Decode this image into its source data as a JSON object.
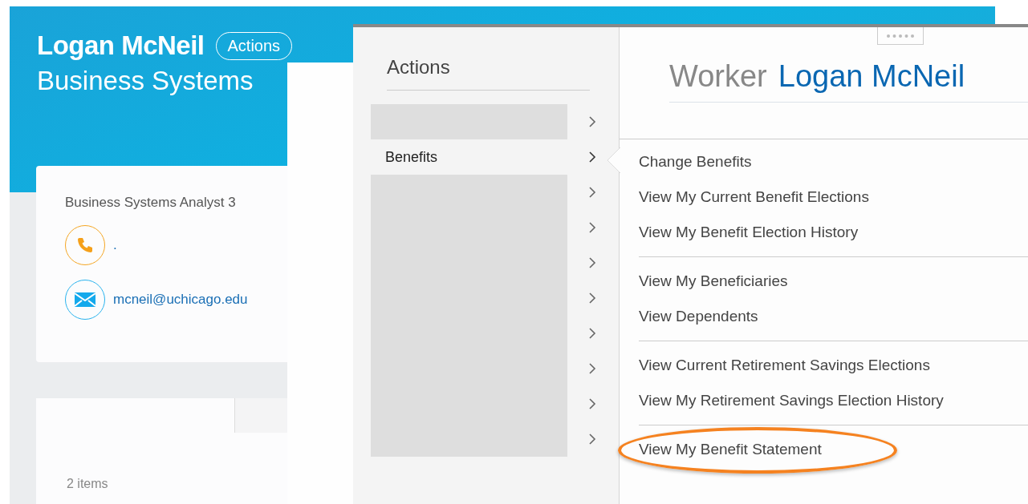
{
  "profile": {
    "name": "Logan McNeil",
    "actions_button": "Actions",
    "subtitle": "Business Systems",
    "job_title": "Business Systems Analyst 3",
    "phone": ".",
    "email": "mcneil@uchicago.edu",
    "items_count": "2 items"
  },
  "actions_menu": {
    "title": "Actions",
    "items": [
      {
        "kind": "redacted"
      },
      {
        "kind": "item",
        "label": "Benefits",
        "expanded": true
      },
      {
        "kind": "redacted"
      },
      {
        "kind": "redacted"
      },
      {
        "kind": "redacted"
      },
      {
        "kind": "redacted"
      },
      {
        "kind": "redacted"
      },
      {
        "kind": "redacted"
      },
      {
        "kind": "redacted"
      },
      {
        "kind": "redacted"
      }
    ]
  },
  "worker_panel": {
    "label": "Worker",
    "name": "Logan McNeil"
  },
  "submenu": {
    "groups": [
      [
        {
          "label": "Change Benefits",
          "highlighted": false
        },
        {
          "label": "View My Current Benefit Elections",
          "highlighted": false
        },
        {
          "label": "View My Benefit Election History",
          "highlighted": false
        }
      ],
      [
        {
          "label": "View My Beneficiaries",
          "highlighted": false
        },
        {
          "label": "View Dependents",
          "highlighted": false
        }
      ],
      [
        {
          "label": "View Current Retirement Savings Elections",
          "highlighted": false
        },
        {
          "label": "View My Retirement Savings Election History",
          "highlighted": false
        }
      ],
      [
        {
          "label": "View My Benefit Statement",
          "highlighted": true
        }
      ]
    ]
  }
}
